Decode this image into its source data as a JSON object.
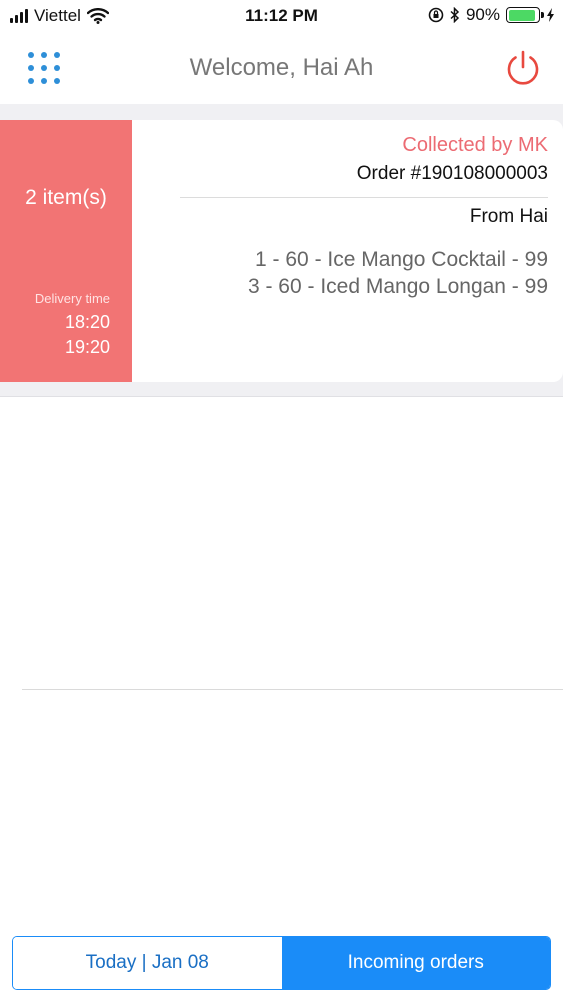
{
  "status_bar": {
    "carrier": "Viettel",
    "time": "11:12 PM",
    "battery": "90%",
    "battery_level": 0.9,
    "icons": [
      "signal-icon",
      "wifi-icon",
      "orientation-lock-icon",
      "bluetooth-icon",
      "battery-icon",
      "charging-icon"
    ]
  },
  "header": {
    "title": "Welcome, Hai Ah",
    "menu_icon": "grid-menu-icon",
    "power_icon": "power-icon"
  },
  "order": {
    "items_count": "2 item(s)",
    "delivery_label": "Delivery time",
    "delivery_times": [
      "18:20",
      "19:20"
    ],
    "status": "Collected by MK",
    "order_number": "Order #190108000003",
    "from": "From Hai",
    "line_items": [
      "1 - 60 - Ice Mango Cocktail - 99",
      "3 - 60 - Iced Mango Longan - 99"
    ]
  },
  "tabs": {
    "today": "Today | Jan 08",
    "incoming": "Incoming orders"
  },
  "colors": {
    "accent": "#1a8cf8",
    "order_panel": "#f27474",
    "status_text": "#ec6b73",
    "power_icon": "#e8493f",
    "menu_icon": "#2e8fd8",
    "battery": "#4cd964"
  }
}
